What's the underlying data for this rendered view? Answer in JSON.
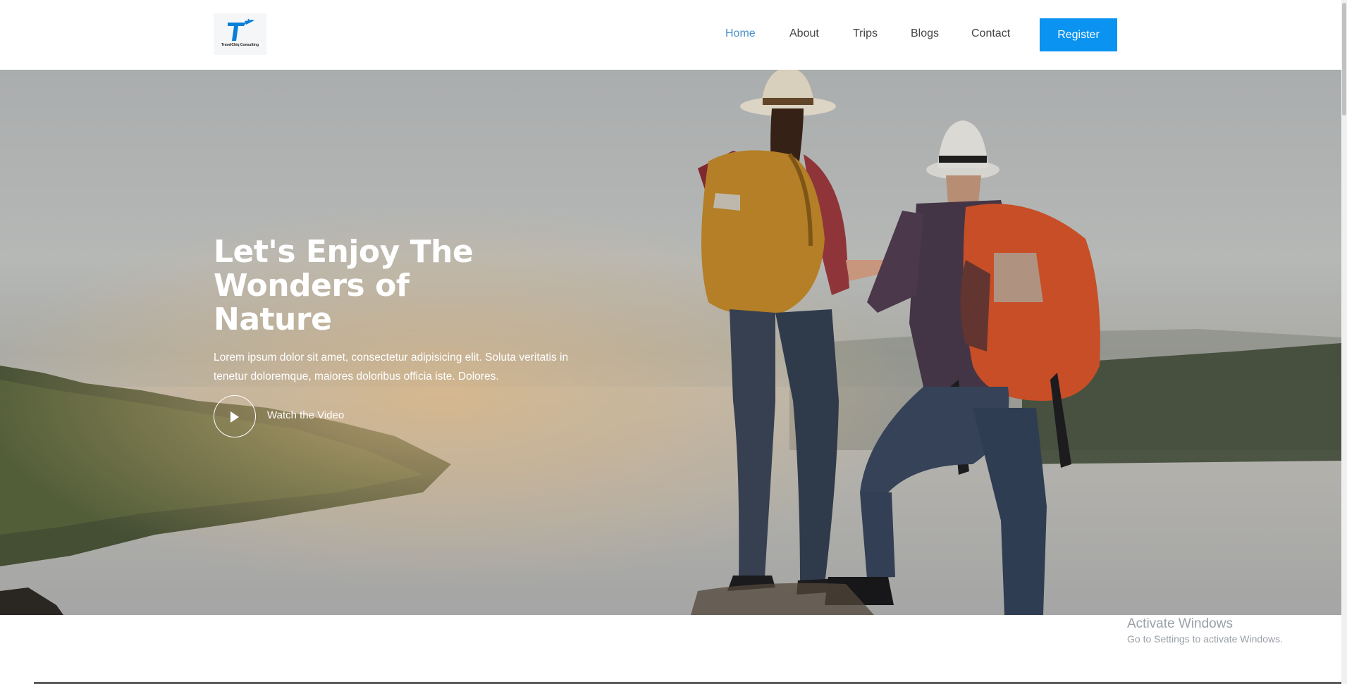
{
  "logo": {
    "text": "TravelChiq Consulting"
  },
  "nav": {
    "items": [
      {
        "label": "Home",
        "active": true
      },
      {
        "label": "About",
        "active": false
      },
      {
        "label": "Trips",
        "active": false
      },
      {
        "label": "Blogs",
        "active": false
      },
      {
        "label": "Contact",
        "active": false
      }
    ],
    "register_label": "Register"
  },
  "hero": {
    "title": "Let's Enjoy The Wonders of Nature",
    "description": "Lorem ipsum dolor sit amet, consectetur adipisicing elit. Soluta veritatis in tenetur doloremque, maiores doloribus officia iste. Dolores.",
    "video_label": "Watch the Video"
  },
  "watermark": {
    "title": "Activate Windows",
    "subtitle": "Go to Settings to activate Windows."
  },
  "colors": {
    "accent": "#0a93f0",
    "nav_active": "#4a90c8",
    "nav_text": "#444444"
  },
  "icons": [
    "play-icon",
    "logo-plane-icon"
  ]
}
